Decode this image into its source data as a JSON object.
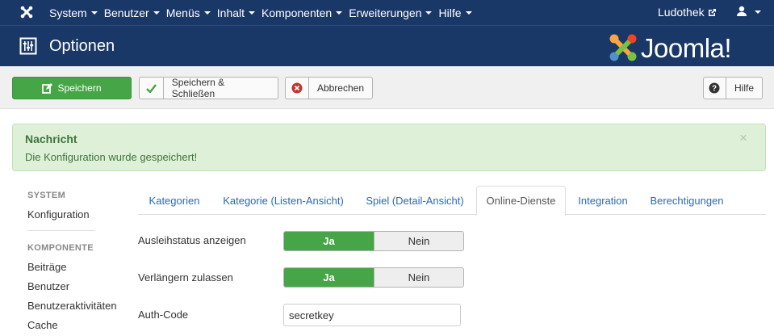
{
  "topnav": {
    "menu": [
      "System",
      "Benutzer",
      "Menüs",
      "Inhalt",
      "Komponenten",
      "Erweiterungen",
      "Hilfe"
    ],
    "site_name": "Ludothek"
  },
  "header": {
    "title": "Optionen",
    "brand": "Joomla!"
  },
  "toolbar": {
    "save_label": "Speichern",
    "save_close_label": "Speichern & Schließen",
    "cancel_label": "Abbrechen",
    "help_label": "Hilfe"
  },
  "alert": {
    "heading": "Nachricht",
    "message": "Die Konfiguration wurde gespeichert!",
    "close": "×"
  },
  "sidebar": {
    "system_heading": "SYSTEM",
    "system_items": [
      "Konfiguration"
    ],
    "component_heading": "KOMPONENTE",
    "component_items": [
      "Beiträge",
      "Benutzer",
      "Benutzeraktivitäten",
      "Cache"
    ]
  },
  "tabs": [
    "Kategorien",
    "Kategorie (Listen-Ansicht)",
    "Spiel (Detail-Ansicht)",
    "Online-Dienste",
    "Integration",
    "Berechtigungen"
  ],
  "active_tab": "Online-Dienste",
  "form": {
    "ausleih_label": "Ausleihstatus anzeigen",
    "verlaengern_label": "Verlängern zulassen",
    "yes": "Ja",
    "no": "Nein",
    "ausleih_value": "Ja",
    "verlaengern_value": "Ja",
    "authcode_label": "Auth-Code",
    "authcode_value": "secretkey"
  },
  "colors": {
    "nav_bg": "#1a3867",
    "success": "#46a546",
    "alert_bg": "#dff0d8",
    "link": "#2a69b8"
  }
}
